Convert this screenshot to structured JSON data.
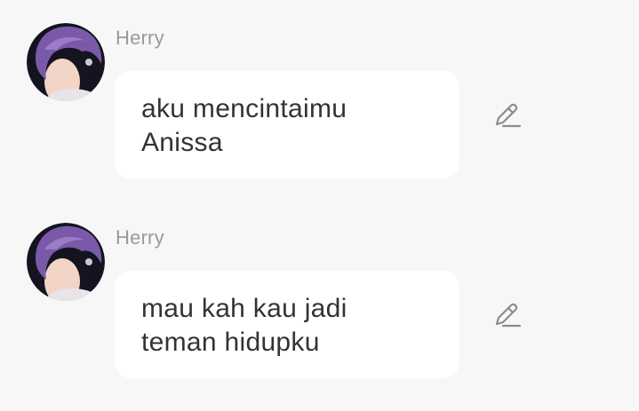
{
  "colors": {
    "background": "#f7f7f7",
    "bubble": "#ffffff",
    "sender_text": "#9a9a9a",
    "message_text": "#333333",
    "icon": "#8c8c8c"
  },
  "messages": [
    {
      "sender": "Herry",
      "text": "aku mencintaimu\nAnissa",
      "avatar_icon": "user-avatar-photo",
      "action_icon": "pencil-edit-icon"
    },
    {
      "sender": "Herry",
      "text": "mau kah kau jadi\nteman hidupku",
      "avatar_icon": "user-avatar-photo",
      "action_icon": "pencil-edit-icon"
    }
  ]
}
